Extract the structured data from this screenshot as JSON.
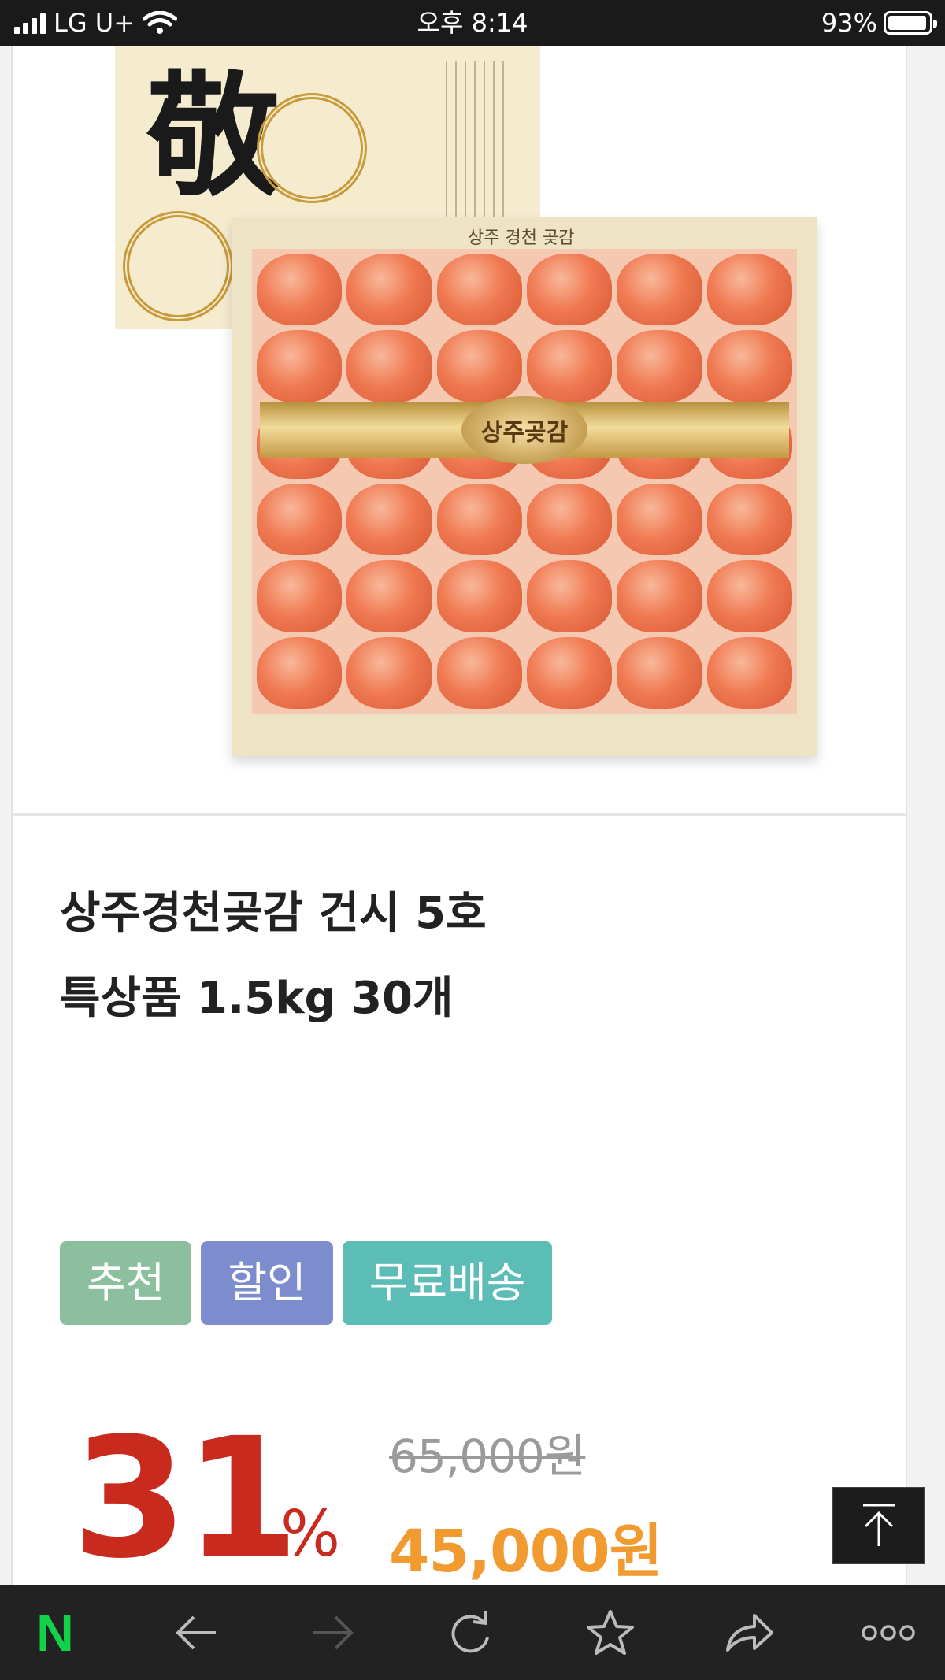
{
  "status_bar": {
    "carrier": "LG U+",
    "time": "오후 8:14",
    "battery": "93%"
  },
  "product": {
    "image": {
      "lid_character": "敬",
      "tray_title": "상주 경천 곶감",
      "band_label": "상주곶감"
    },
    "title": "상주경천곶감 건시 5호\n특상품 1.5kg 30개",
    "tags": [
      "추천",
      "할인",
      "무료배송"
    ],
    "discount": {
      "value": "31",
      "unit": "%"
    },
    "original_price": "65,000원",
    "sale_price": "45,000원"
  },
  "toolbar": {
    "logo": "N",
    "icons": [
      "back-icon",
      "forward-icon",
      "refresh-icon",
      "star-icon",
      "share-icon",
      "more-icon"
    ]
  },
  "colors": {
    "discount": "#c92a1e",
    "sale_price": "#f09a30",
    "tag_recommend": "#8bbf9d",
    "tag_sale": "#7d8ccd",
    "tag_free_shipping": "#5cbcb6",
    "naver_green": "#12d24a"
  }
}
